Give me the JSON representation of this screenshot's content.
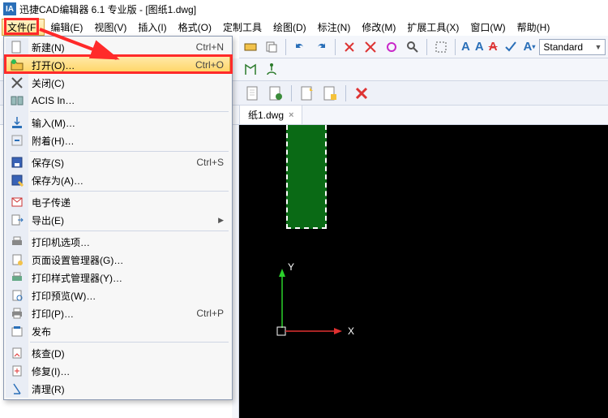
{
  "window": {
    "title": "迅捷CAD编辑器 6.1 专业版  - [图纸1.dwg]",
    "app_icon_text": "IA"
  },
  "menu": {
    "file": "文件(F)",
    "edit": "编辑(E)",
    "view": "视图(V)",
    "insert": "插入(I)",
    "format": "格式(O)",
    "custom_tools": "定制工具",
    "draw": "绘图(D)",
    "annotate": "标注(N)",
    "modify": "修改(M)",
    "extension_tools": "扩展工具(X)",
    "window": "窗口(W)",
    "help": "帮助(H)"
  },
  "file_menu": {
    "new": "新建(N)",
    "new_sc": "Ctrl+N",
    "open": "打开(O)…",
    "open_sc": "Ctrl+O",
    "close": "关闭(C)",
    "acis": "ACIS In…",
    "input": "输入(M)…",
    "attach": "附着(H)…",
    "save": "保存(S)",
    "save_sc": "Ctrl+S",
    "save_as": "保存为(A)…",
    "etransmit": "电子传递",
    "export": "导出(E)",
    "printer_options": "打印机选项…",
    "page_setup": "页面设置管理器(G)…",
    "plot_styles": "打印样式管理器(Y)…",
    "print_preview": "打印预览(W)…",
    "print": "打印(P)…",
    "print_sc": "Ctrl+P",
    "publish": "发布",
    "audit": "核查(D)",
    "repair": "修复(I)…",
    "cleanup": "清理(R)"
  },
  "tab": {
    "name": "纸1.dwg",
    "close": "×"
  },
  "style_dropdown": {
    "value": "Standard"
  },
  "axis_labels": {
    "x": "X",
    "y": "Y"
  },
  "colors": {
    "highlight_red": "#ff2a2a",
    "arrow_red": "#ff2a2a",
    "menu_hover_bg": "#ffe08a",
    "canvas_bg": "#000000",
    "green_rect": "#0a6a15"
  }
}
